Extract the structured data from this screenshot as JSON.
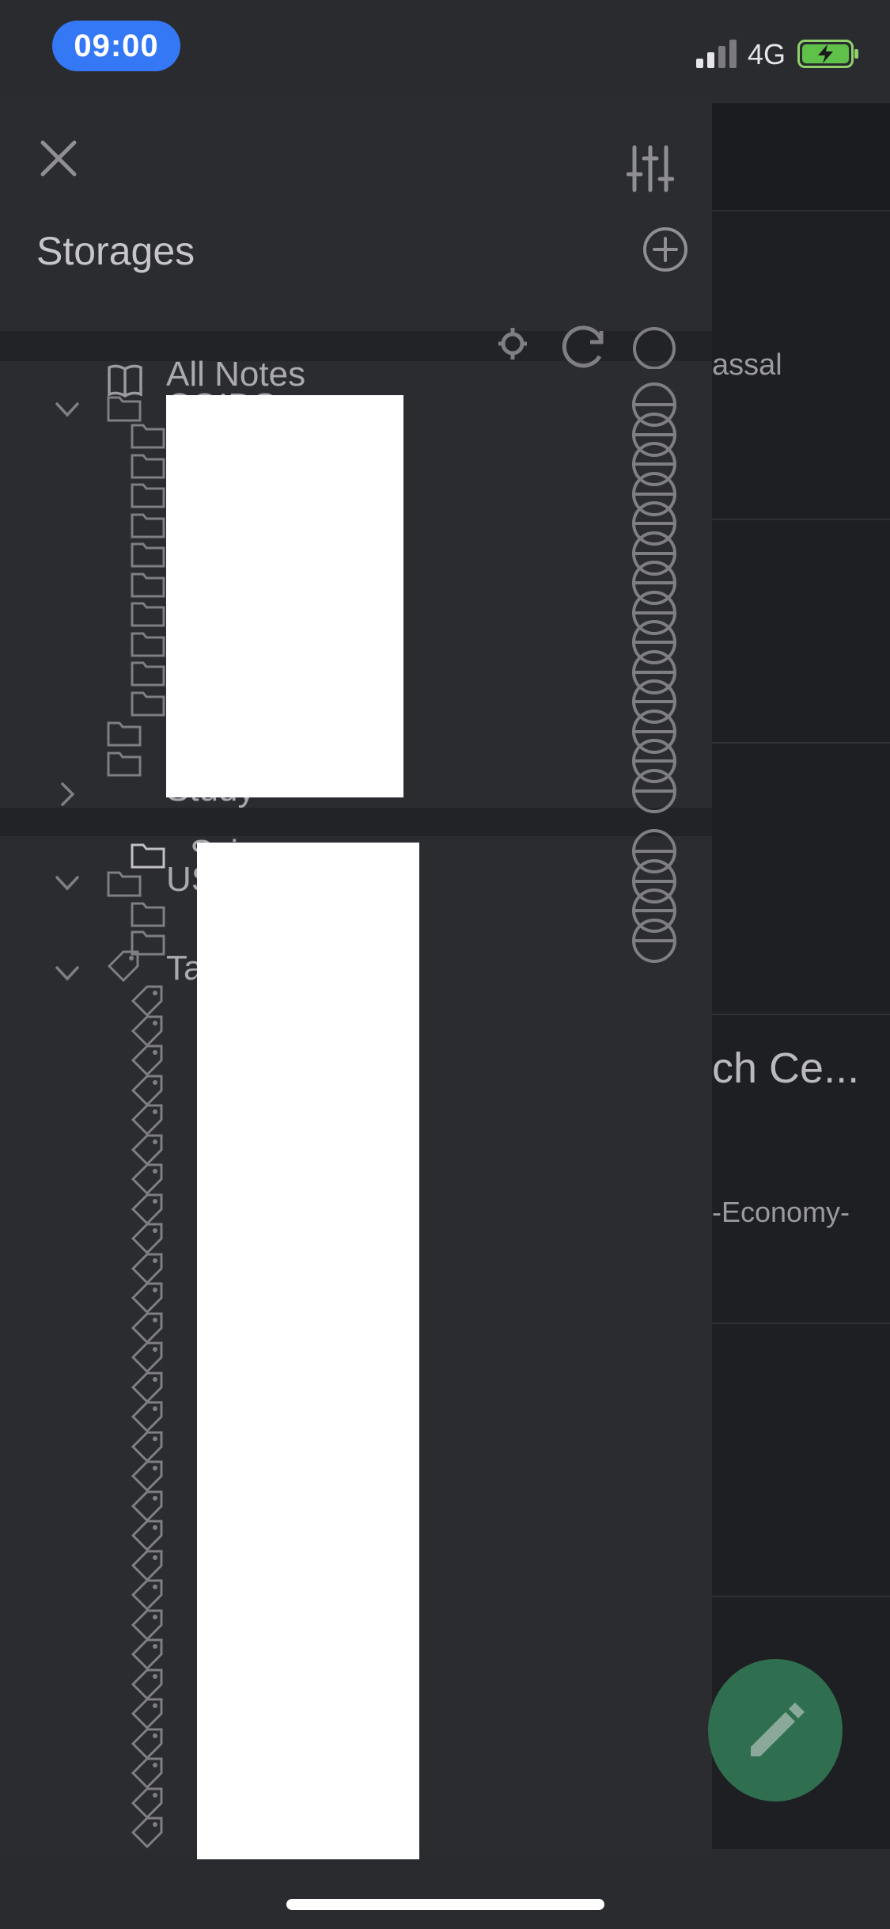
{
  "status_bar": {
    "time": "09:00",
    "network": "4G"
  },
  "drawer": {
    "title": "Storages",
    "all_notes_label": "All Notes",
    "folders_group_label": "COIDS",
    "study_label": "Study",
    "sub_item_label": "Sci",
    "us_group_label": "US",
    "tags_group_label": "Ta"
  },
  "background_list": {
    "snippets": [
      "assal",
      "ch Ce...",
      "-Economy-"
    ]
  },
  "icons": [
    "close-icon",
    "filter-sliders-icon",
    "add-circle-icon",
    "book-icon",
    "folder-icon",
    "tag-icon",
    "chevron-down-icon",
    "chevron-right-icon",
    "pencil-icon",
    "gear-icon",
    "sync-icon"
  ],
  "colors": {
    "accent_blue": "#3478f6",
    "fab_green": "#2f6e4f",
    "drawer_bg": "#2b2c30"
  }
}
